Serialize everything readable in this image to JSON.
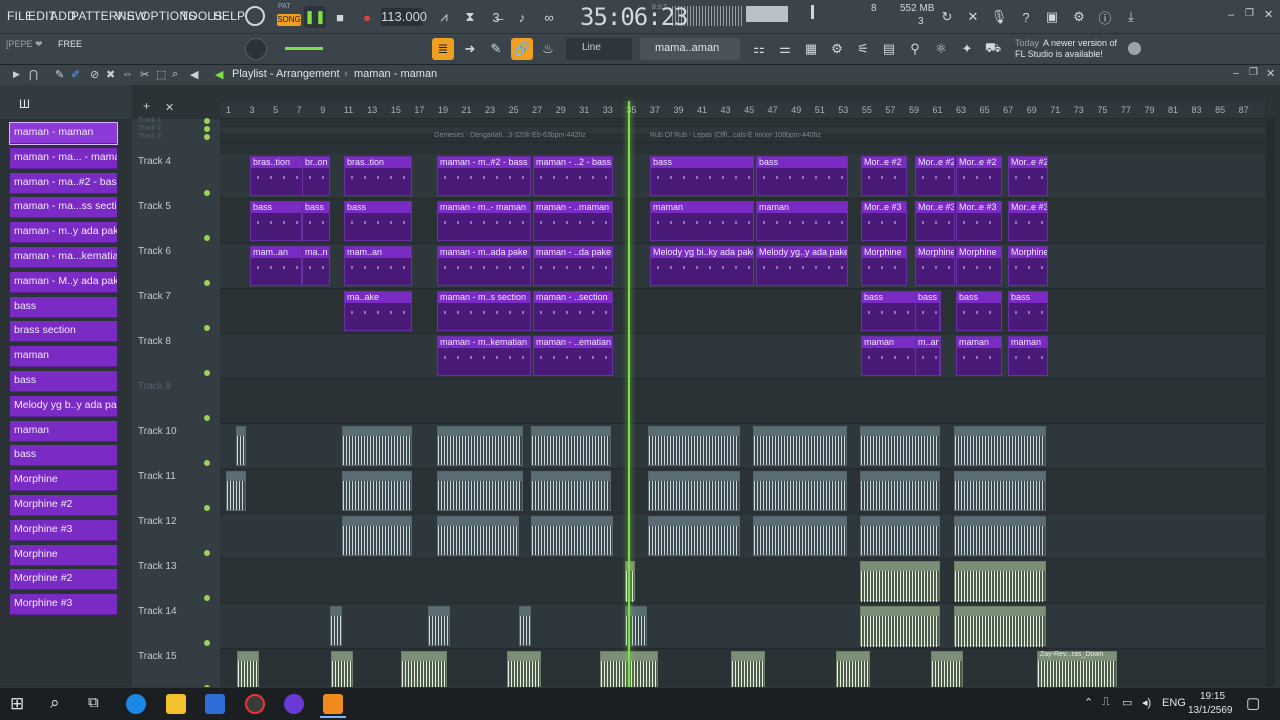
{
  "menu": [
    "FILE",
    "EDIT",
    "ADD",
    "PATTERNS",
    "VIEW",
    "OPTIONS",
    "TOOLS",
    "HELP"
  ],
  "transport": {
    "mode_top": "PAT",
    "mode_label": "SONG",
    "tempo": "113.000",
    "clock": "35:06:23",
    "clock_small": "B:S:T",
    "cpu_num": "8",
    "mem": "552 MB",
    "voices": "3"
  },
  "toolbar2": {
    "user": "[PEPE ❤",
    "license": "FREE",
    "snap": "Line",
    "pattern": "mama..aman",
    "news_date": "Today",
    "news_text": "A newer version of",
    "news_text2": "FL Studio is available!"
  },
  "playlist": {
    "title": "Playlist - Arrangement",
    "separator": "›",
    "pattern_name": "maman - maman"
  },
  "ruler": [
    "1",
    "3",
    "5",
    "7",
    "9",
    "11",
    "13",
    "15",
    "17",
    "19",
    "21",
    "23",
    "25",
    "27",
    "29",
    "31",
    "33",
    "35",
    "37",
    "39",
    "41",
    "43",
    "45",
    "47",
    "49",
    "51",
    "53",
    "55",
    "57",
    "59",
    "61",
    "63",
    "65",
    "67",
    "69",
    "71",
    "73",
    "75",
    "77",
    "79",
    "81",
    "83",
    "85",
    "87"
  ],
  "audio_labels": {
    "a": "Gemeses - Dengarlah...3-320k-Eb-63bpm-442hz",
    "b": "Rub Of Rub - Lepas (Offi...cals-E minor-108bpm-440hz",
    "c": "Zay-Rev...ras_Down"
  },
  "picker": [
    "maman - maman",
    "maman - ma... - maman",
    "maman - ma..#2 - bass",
    "maman - ma...ss section",
    "maman - m..y ada pake",
    "maman - ma...kematian",
    "maman - M..y ada pake",
    "bass",
    "brass section",
    "maman",
    "bass",
    "Melody yg b..y ada pake",
    "maman",
    "bass",
    "Morphine",
    "Morphine #2",
    "Morphine #3",
    "Morphine",
    "Morphine #2",
    "Morphine #3"
  ],
  "tracks": [
    "Track 1",
    "Track 2",
    "Track 3",
    "Track 4",
    "Track 5",
    "Track 6",
    "Track 7",
    "Track 8",
    "Track 9",
    "Track 10",
    "Track 11",
    "Track 12",
    "Track 13",
    "Track 14",
    "Track 15"
  ],
  "clips": {
    "t4": [
      "bras..tion",
      "br..on",
      "bras..tion",
      "maman - m..#2 - bass",
      "maman - ..2 - bass",
      "bass",
      "bass",
      "Mor..e #2",
      "Mor..e #2",
      "Mor..e #2",
      "Mor..e #2"
    ],
    "t5": [
      "bass",
      "bass",
      "bass",
      "maman - m..- maman",
      "maman - ..maman",
      "maman",
      "maman",
      "Mor..e #3",
      "Mor..e #3",
      "Mor..e #3",
      "Mor..e #3"
    ],
    "t6": [
      "mam..an",
      "ma..n",
      "mam..an",
      "maman - m..ada pake",
      "maman - ..da pake",
      "Melody yg bi..ky ada pake",
      "Melody yg..y ada pake",
      "Morphine",
      "Morphine",
      "Morphine",
      "Morphine"
    ],
    "t7": [
      "ma..ake",
      "maman - m..s section",
      "maman - ..section",
      "bass",
      "bass",
      "bass",
      "bass"
    ],
    "t8": [
      "maman - m..kematian",
      "maman - ..ematian",
      "maman",
      "m..an",
      "maman",
      "maman"
    ]
  },
  "taskbar": {
    "lang": "ENG",
    "time": "19:15",
    "date": "13/1/2569"
  }
}
